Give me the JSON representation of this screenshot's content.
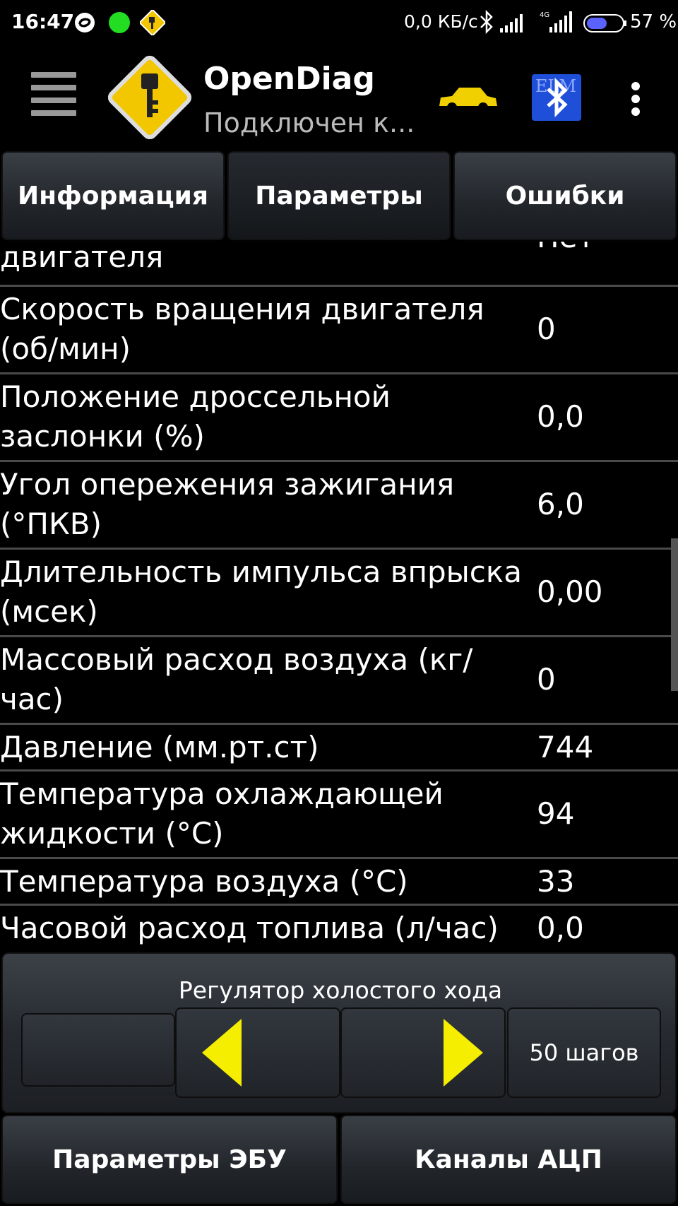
{
  "status_bar": {
    "time": "16:47",
    "net_speed": "0,0 КБ/с",
    "battery_percent": "57 %",
    "network_badge": "4G",
    "icons": [
      "sync-icon",
      "green-dot-icon",
      "key-notification-icon",
      "bluetooth-icon",
      "signal-icon",
      "signal-4g-icon",
      "battery-icon"
    ]
  },
  "action_bar": {
    "title": "OpenDiag",
    "subtitle": "Подключен к...",
    "elm_badge": "ELM 327",
    "icons": [
      "menu-icon",
      "app-logo-key-icon",
      "car-icon",
      "elm-bluetooth-icon",
      "overflow-menu-icon"
    ]
  },
  "tabs": [
    {
      "label": "Информация",
      "active": false
    },
    {
      "label": "Параметры",
      "active": true
    },
    {
      "label": "Ошибки",
      "active": false
    }
  ],
  "table": {
    "partial_top_row": {
      "label": "двигателя",
      "value": "Нет"
    },
    "rows": [
      {
        "label": "Скорость вращения двигателя (об/мин)",
        "value": "0"
      },
      {
        "label": "Положение дроссельной заслонки (%)",
        "value": "0,0"
      },
      {
        "label": "Угол опережения зажигания (°ПКВ)",
        "value": "6,0"
      },
      {
        "label": "Длительность импульса впрыска (мсек)",
        "value": "0,00"
      },
      {
        "label": "Массовый расход воздуха (кг/час)",
        "value": "0"
      },
      {
        "label": "Давление (мм.рт.ст)",
        "value": "744"
      },
      {
        "label": "Температура охлаждающей жидкости (°C)",
        "value": "94"
      },
      {
        "label": "Температура воздуха (°C)",
        "value": "33"
      },
      {
        "label": "Часовой расход топлива (л/час)",
        "value": "0,0"
      }
    ]
  },
  "regulator": {
    "title": "Регулятор холостого хода",
    "steps_label": "50 шагов",
    "arrow_color": "#f5ee00"
  },
  "bottom_buttons": {
    "ecu_params": "Параметры ЭБУ",
    "adc_channels": "Каналы АЦП"
  },
  "colors": {
    "background": "#000000",
    "logo_yellow": "#f2c700",
    "car_yellow": "#f0d000",
    "elm_blue": "#1f4fd8"
  }
}
